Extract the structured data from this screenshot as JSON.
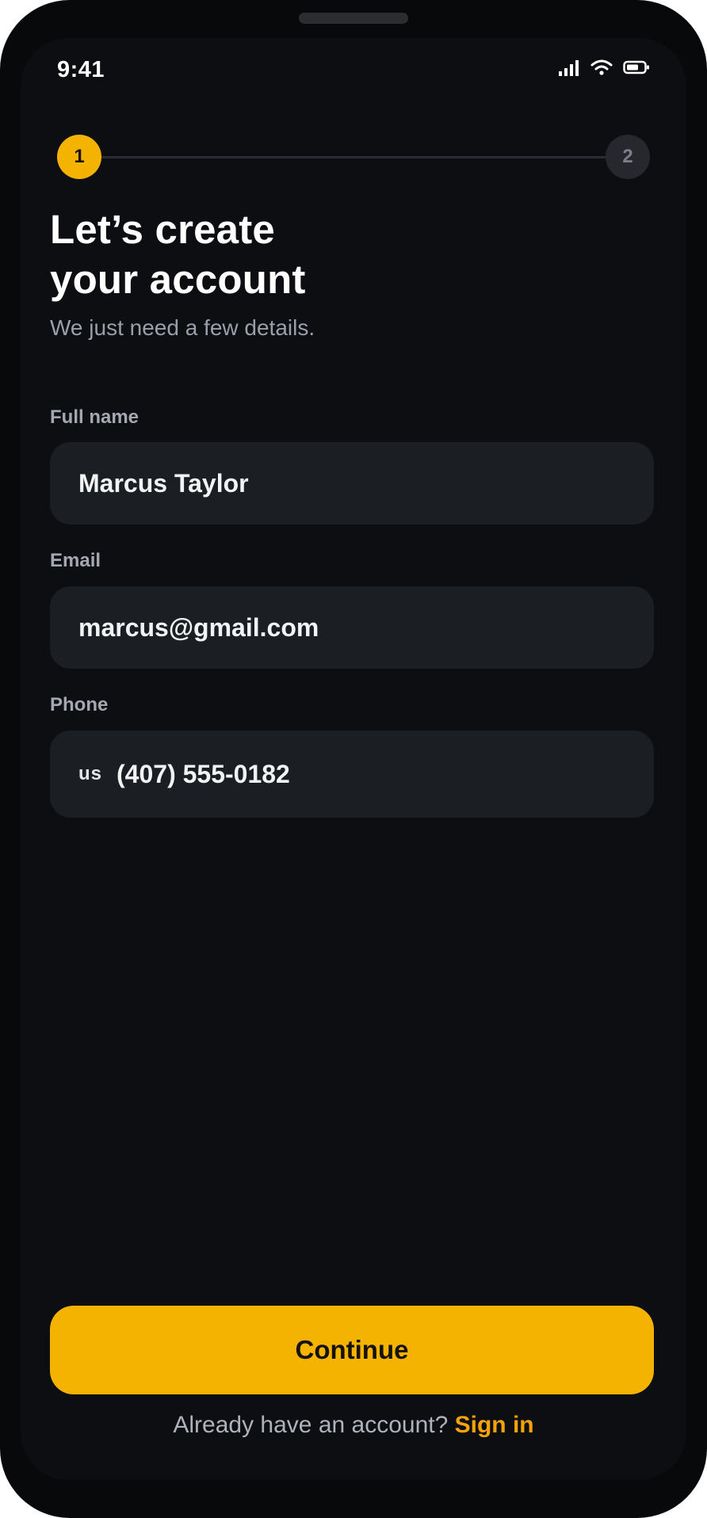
{
  "status_bar": {
    "time": "9:41"
  },
  "stepper": {
    "step1": "1",
    "step2": "2"
  },
  "header": {
    "title_line1": "Let’s create",
    "title_line2": "your account",
    "subtitle": "We just need a few details."
  },
  "form": {
    "full_name": {
      "label": "Full name",
      "value": "Marcus Taylor"
    },
    "email": {
      "label": "Email",
      "value": "marcus@gmail.com"
    },
    "phone": {
      "label": "Phone",
      "country_code": "us",
      "value": "(407) 555-0182"
    }
  },
  "actions": {
    "continue_label": "Continue"
  },
  "footer": {
    "prompt": "Already have an account?",
    "link": "Sign in"
  },
  "colors": {
    "accent": "#f5b301",
    "link": "#f5a30b",
    "background": "#0d0e11",
    "field_bg": "#1b1e23"
  },
  "icons": [
    "cellular-signal-icon",
    "wifi-icon",
    "battery-icon"
  ]
}
